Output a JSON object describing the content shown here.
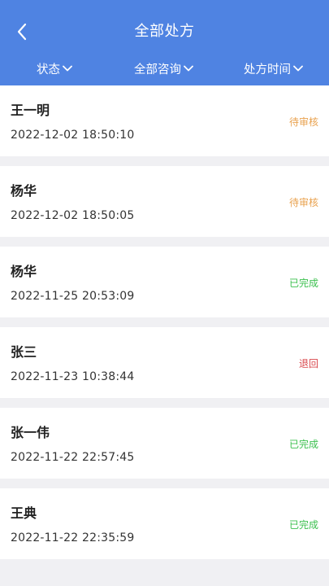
{
  "header": {
    "title": "全部处方",
    "back_icon": "chevron-left-icon"
  },
  "filters": [
    {
      "label": "状态"
    },
    {
      "label": "全部咨询"
    },
    {
      "label": "处方时间"
    }
  ],
  "colors": {
    "header_bg": "#4f83e2",
    "pending": "#e9a24f",
    "done": "#3cc04f",
    "returned": "#d9474c"
  },
  "items": [
    {
      "name": "王一明",
      "time": "2022-12-02 18:50:10",
      "status": "待审核",
      "status_type": "pending"
    },
    {
      "name": "杨华",
      "time": "2022-12-02 18:50:05",
      "status": "待审核",
      "status_type": "pending"
    },
    {
      "name": "杨华",
      "time": "2022-11-25 20:53:09",
      "status": "已完成",
      "status_type": "done"
    },
    {
      "name": "张三",
      "time": "2022-11-23 10:38:44",
      "status": "退回",
      "status_type": "back"
    },
    {
      "name": "张一伟",
      "time": "2022-11-22 22:57:45",
      "status": "已完成",
      "status_type": "done"
    },
    {
      "name": "王典",
      "time": "2022-11-22 22:35:59",
      "status": "已完成",
      "status_type": "done"
    }
  ]
}
